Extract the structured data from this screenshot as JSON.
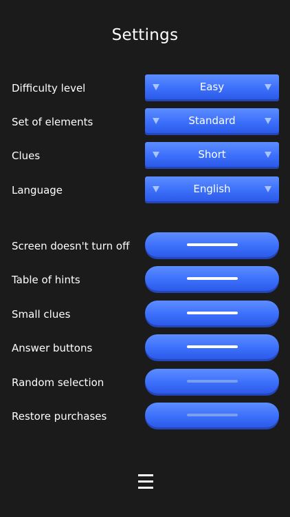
{
  "page": {
    "title": "Settings"
  },
  "selects": [
    {
      "label": "Difficulty level",
      "value": "Easy"
    },
    {
      "label": "Set of elements",
      "value": "Standard"
    },
    {
      "label": "Clues",
      "value": "Short"
    },
    {
      "label": "Language",
      "value": "English"
    }
  ],
  "toggles": [
    {
      "label": "Screen doesn't turn off",
      "state": "on"
    },
    {
      "label": "Table of hints",
      "state": "on"
    },
    {
      "label": "Small clues",
      "state": "on"
    },
    {
      "label": "Answer buttons",
      "state": "on"
    },
    {
      "label": "Random selection",
      "state": "off"
    },
    {
      "label": "Restore purchases",
      "state": "off"
    }
  ],
  "icons": {
    "select_arrow": "triangle-down-icon",
    "menu": "hamburger-menu-icon"
  },
  "colors": {
    "background": "#1b1b1b",
    "button": "#3c70fb",
    "button_shadow": "#2446b8",
    "arrow": "#a9c4ff",
    "toggle_on": "#ffffff",
    "toggle_off": "#7b9eef"
  }
}
